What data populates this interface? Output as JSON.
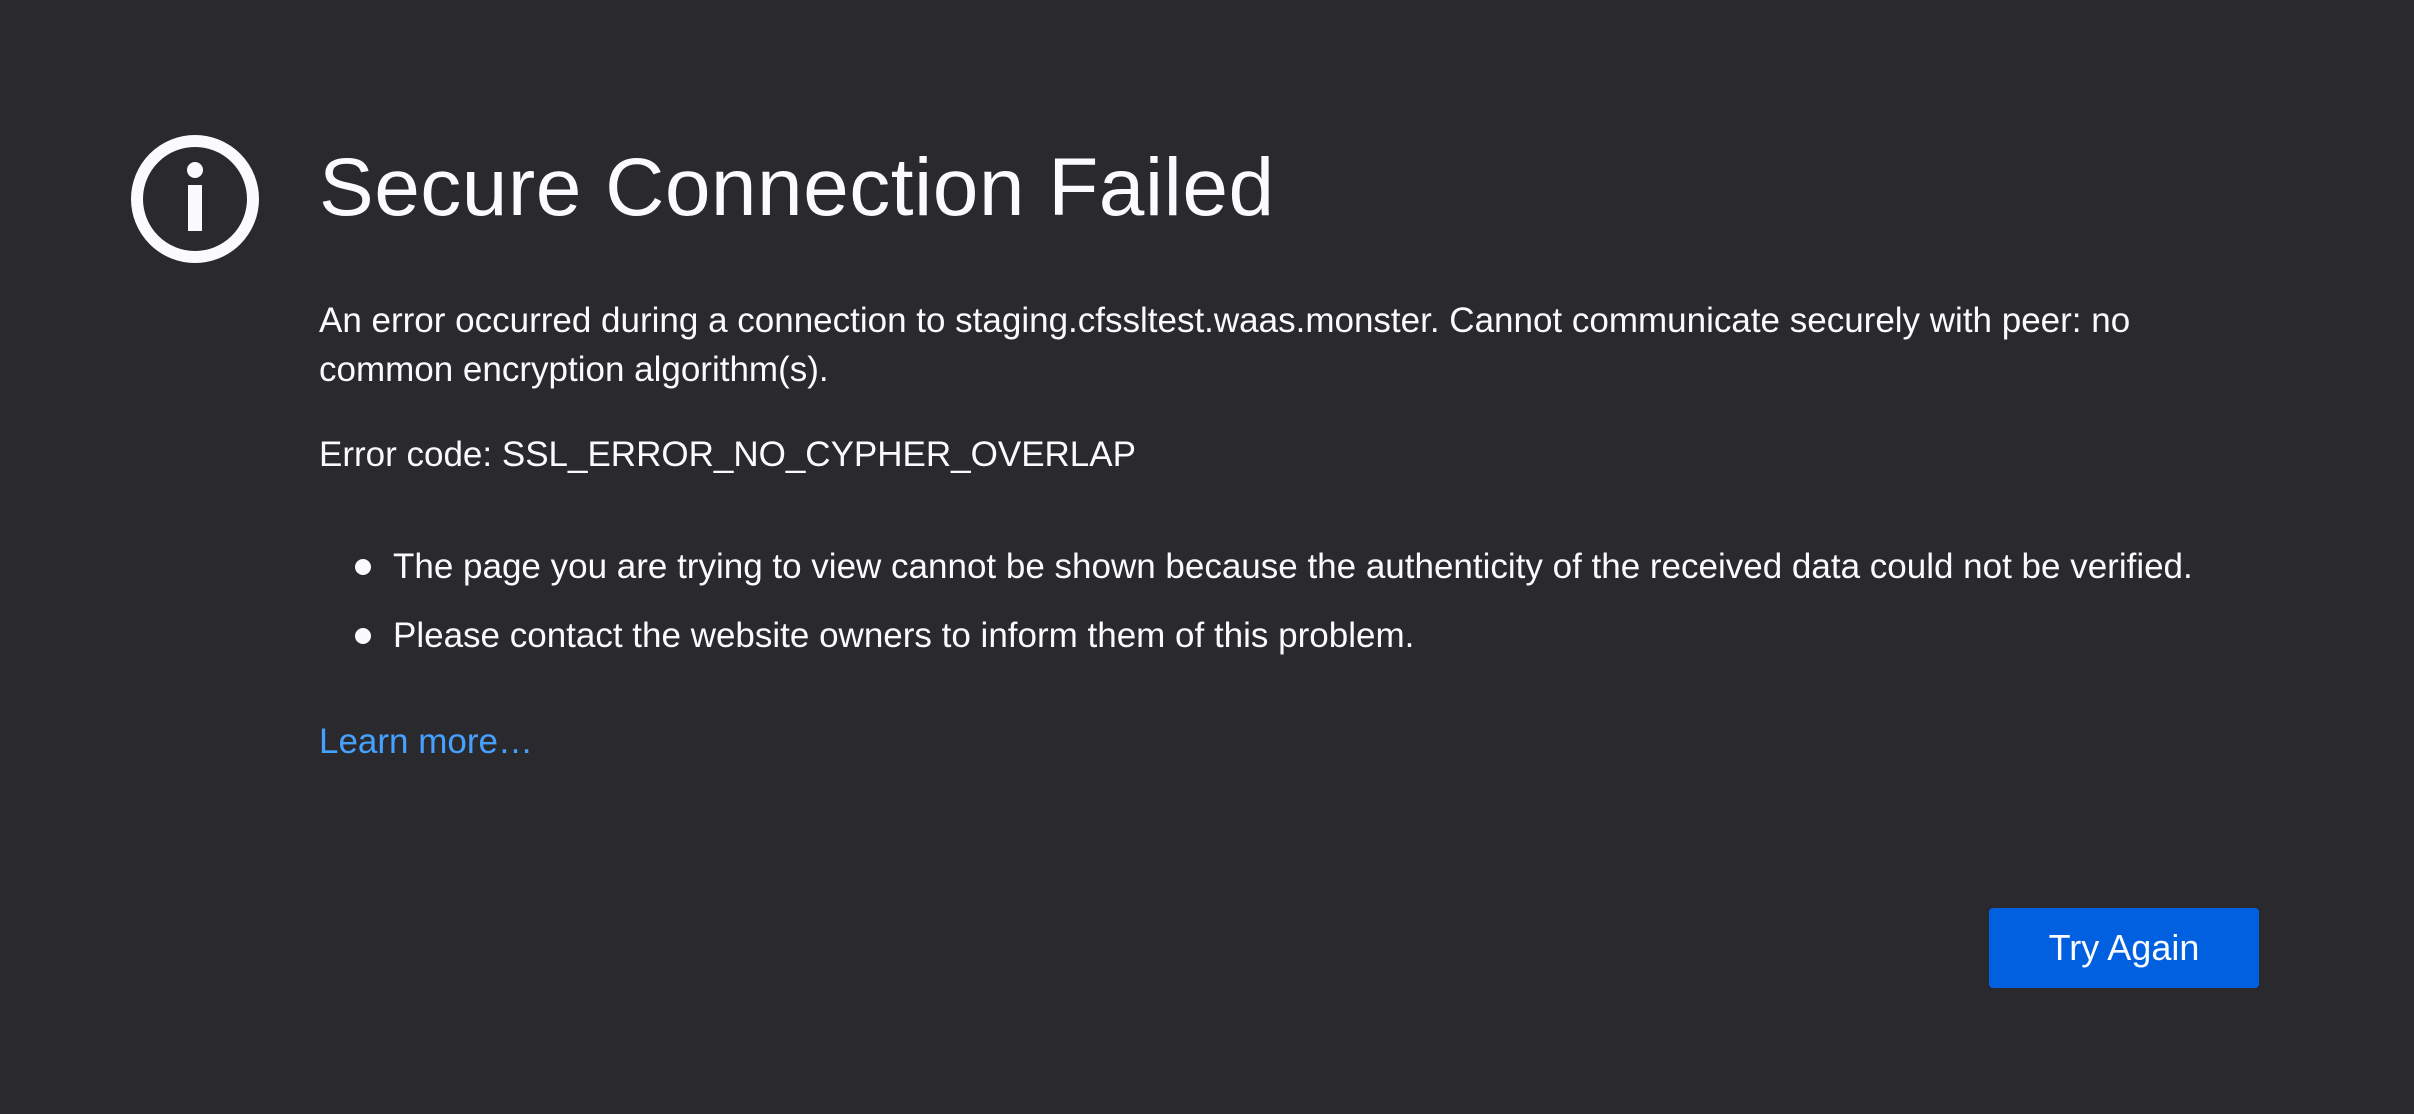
{
  "error_page": {
    "icon": "info-icon",
    "title": "Secure Connection Failed",
    "description": "An error occurred during a connection to staging.cfssltest.waas.monster. Cannot communicate securely with peer: no common encryption algorithm(s).",
    "error_code": "Error code: SSL_ERROR_NO_CYPHER_OVERLAP",
    "bullets": [
      "The page you are trying to view cannot be shown because the authenticity of the received data could not be verified.",
      "Please contact the website owners to inform them of this problem."
    ],
    "learn_more_label": "Learn more…",
    "try_again_label": "Try Again"
  },
  "colors": {
    "background": "#2a2a2e",
    "text": "#fbfbfe",
    "link": "#45a1ff",
    "primary_button": "#0060df"
  }
}
